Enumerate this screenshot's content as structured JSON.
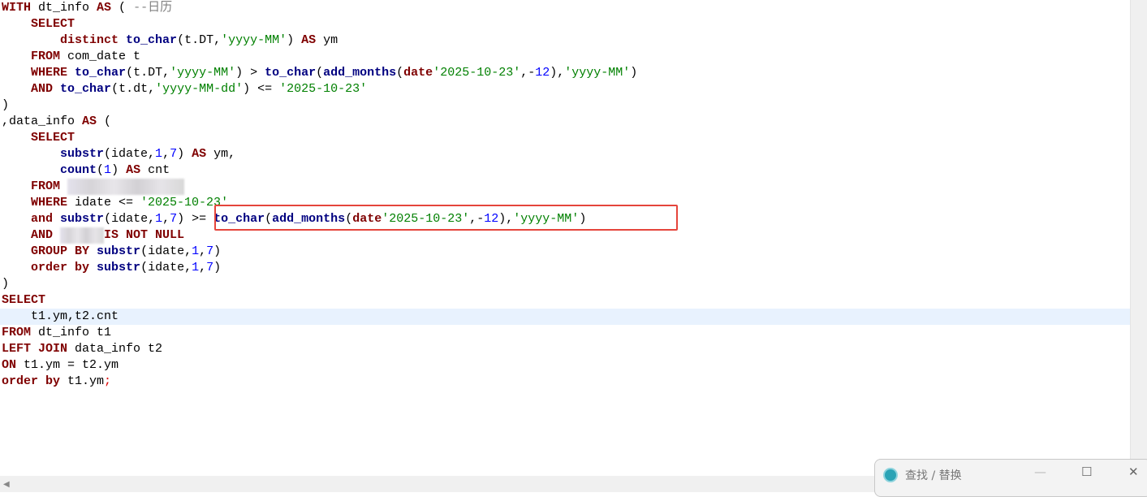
{
  "editor": {
    "lines": [
      [
        [
          "k",
          "WITH"
        ],
        [
          "p",
          " dt_info "
        ],
        [
          "k",
          "AS"
        ],
        [
          "p",
          " ( "
        ],
        [
          "c",
          "--日历"
        ]
      ],
      [
        [
          "p",
          "    "
        ],
        [
          "k",
          "SELECT"
        ]
      ],
      [
        [
          "p",
          "        "
        ],
        [
          "k",
          "distinct"
        ],
        [
          "p",
          " "
        ],
        [
          "f",
          "to_char"
        ],
        [
          "p",
          "(t.DT,"
        ],
        [
          "s",
          "'yyyy-MM'"
        ],
        [
          "p",
          ") "
        ],
        [
          "k",
          "AS"
        ],
        [
          "p",
          " ym"
        ]
      ],
      [
        [
          "p",
          "    "
        ],
        [
          "k",
          "FROM"
        ],
        [
          "p",
          " com_date t"
        ]
      ],
      [
        [
          "p",
          "    "
        ],
        [
          "k",
          "WHERE"
        ],
        [
          "p",
          " "
        ],
        [
          "f",
          "to_char"
        ],
        [
          "p",
          "(t.DT,"
        ],
        [
          "s",
          "'yyyy-MM'"
        ],
        [
          "p",
          ") > "
        ],
        [
          "f",
          "to_char"
        ],
        [
          "p",
          "("
        ],
        [
          "f",
          "add_months"
        ],
        [
          "p",
          "("
        ],
        [
          "k",
          "date"
        ],
        [
          "s",
          "'2025-10-23'"
        ],
        [
          "p",
          ",-"
        ],
        [
          "n",
          "12"
        ],
        [
          "p",
          "),"
        ],
        [
          "s",
          "'yyyy-MM'"
        ],
        [
          "p",
          ")"
        ]
      ],
      [
        [
          "p",
          "    "
        ],
        [
          "k",
          "AND"
        ],
        [
          "p",
          " "
        ],
        [
          "f",
          "to_char"
        ],
        [
          "p",
          "(t.dt,"
        ],
        [
          "s",
          "'yyyy-MM-dd'"
        ],
        [
          "p",
          ") <= "
        ],
        [
          "s",
          "'2025-10-23'"
        ]
      ],
      [
        [
          "p",
          ")"
        ]
      ],
      [
        [
          "p",
          ",data_info "
        ],
        [
          "k",
          "AS"
        ],
        [
          "p",
          " ("
        ]
      ],
      [
        [
          "p",
          "    "
        ],
        [
          "k",
          "SELECT"
        ]
      ],
      [
        [
          "p",
          "        "
        ],
        [
          "f",
          "substr"
        ],
        [
          "p",
          "(idate,"
        ],
        [
          "n",
          "1"
        ],
        [
          "p",
          ","
        ],
        [
          "n",
          "7"
        ],
        [
          "p",
          ") "
        ],
        [
          "k",
          "AS"
        ],
        [
          "p",
          " ym,"
        ]
      ],
      [
        [
          "p",
          "        "
        ],
        [
          "f",
          "count"
        ],
        [
          "p",
          "("
        ],
        [
          "n",
          "1"
        ],
        [
          "p",
          ") "
        ],
        [
          "k",
          "AS"
        ],
        [
          "p",
          " cnt"
        ]
      ],
      [
        [
          "p",
          "    "
        ],
        [
          "k",
          "FROM"
        ],
        [
          "p",
          " "
        ],
        [
          "blur",
          "16"
        ]
      ],
      [
        [
          "p",
          "    "
        ],
        [
          "k",
          "WHERE"
        ],
        [
          "p",
          " idate <= "
        ],
        [
          "s",
          "'2025-10-23'"
        ]
      ],
      [
        [
          "p",
          "    "
        ],
        [
          "k",
          "and"
        ],
        [
          "p",
          " "
        ],
        [
          "f",
          "substr"
        ],
        [
          "p",
          "(idate,"
        ],
        [
          "n",
          "1"
        ],
        [
          "p",
          ","
        ],
        [
          "n",
          "7"
        ],
        [
          "p",
          ") >= "
        ],
        [
          "f",
          "to_char"
        ],
        [
          "p",
          "("
        ],
        [
          "f",
          "add_months"
        ],
        [
          "p",
          "("
        ],
        [
          "k",
          "date"
        ],
        [
          "s",
          "'2025-10-23'"
        ],
        [
          "p",
          ",-"
        ],
        [
          "n",
          "12"
        ],
        [
          "p",
          "),"
        ],
        [
          "s",
          "'yyyy-MM'"
        ],
        [
          "p",
          ")"
        ]
      ],
      [
        [
          "p",
          "    "
        ],
        [
          "k",
          "AND"
        ],
        [
          "p",
          " "
        ],
        [
          "blur",
          "6"
        ],
        [
          "k",
          "IS NOT NULL"
        ]
      ],
      [
        [
          "p",
          "    "
        ],
        [
          "k",
          "GROUP BY"
        ],
        [
          "p",
          " "
        ],
        [
          "f",
          "substr"
        ],
        [
          "p",
          "(idate,"
        ],
        [
          "n",
          "1"
        ],
        [
          "p",
          ","
        ],
        [
          "n",
          "7"
        ],
        [
          "p",
          ")"
        ]
      ],
      [
        [
          "p",
          "    "
        ],
        [
          "k",
          "order by"
        ],
        [
          "p",
          " "
        ],
        [
          "f",
          "substr"
        ],
        [
          "p",
          "(idate,"
        ],
        [
          "n",
          "1"
        ],
        [
          "p",
          ","
        ],
        [
          "n",
          "7"
        ],
        [
          "p",
          ")"
        ]
      ],
      [
        [
          "p",
          ")"
        ]
      ],
      [
        [
          "k",
          "SELECT"
        ]
      ],
      [
        [
          "p",
          "    t1.ym,t2.cnt"
        ]
      ],
      [
        [
          "k",
          "FROM"
        ],
        [
          "p",
          " dt_info t1"
        ]
      ],
      [
        [
          "k",
          "LEFT JOIN"
        ],
        [
          "p",
          " data_info t2"
        ]
      ],
      [
        [
          "k",
          "ON"
        ],
        [
          "p",
          " t1.ym = t2.ym"
        ]
      ],
      [
        [
          "k",
          "order by"
        ],
        [
          "p",
          " t1.ym"
        ],
        [
          "r",
          ";"
        ]
      ]
    ],
    "current_line": 20
  },
  "find_dialog": {
    "title": "查找 / 替换",
    "minimize": "—",
    "maximize": "☐",
    "close": "✕"
  },
  "colors": {
    "keyword": "#7f0000",
    "function": "#000080",
    "string": "#008000",
    "number": "#0000ff",
    "highlight_box": "#e5453c"
  }
}
